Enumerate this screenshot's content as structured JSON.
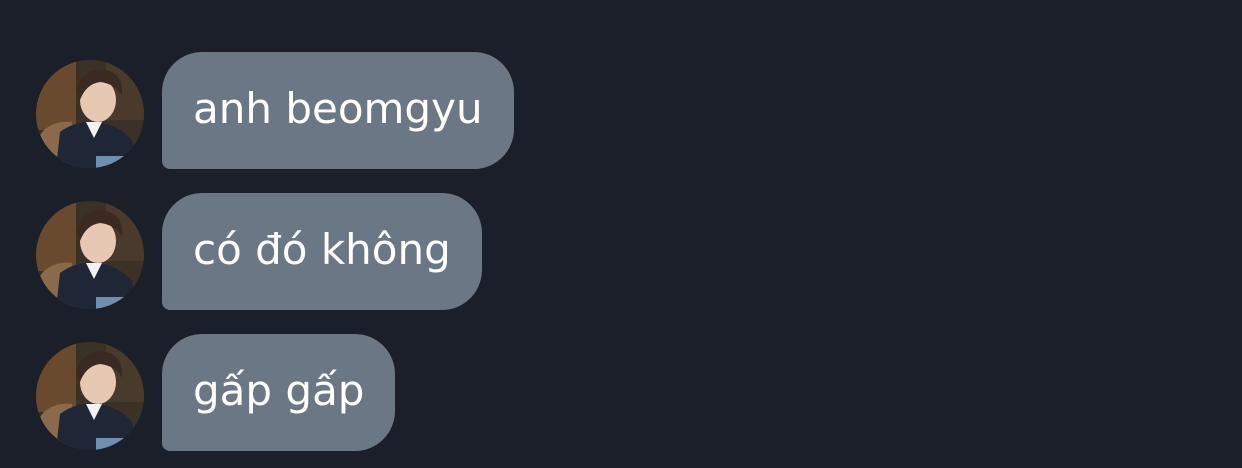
{
  "colors": {
    "background": "#1a1f2a",
    "bubble": "#6b7785",
    "bubble_text": "#ffffff"
  },
  "messages": [
    {
      "text": "anh beomgyu",
      "avatar": "profile-photo"
    },
    {
      "text": "có đó không",
      "avatar": "profile-photo"
    },
    {
      "text": "gấp gấp",
      "avatar": "profile-photo"
    }
  ]
}
